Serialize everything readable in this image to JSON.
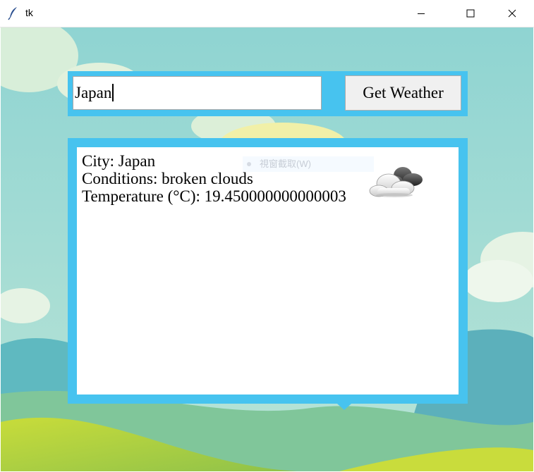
{
  "window": {
    "title": "tk",
    "icon": "feather-icon"
  },
  "search": {
    "value": "Japan",
    "button_label": "Get Weather"
  },
  "result": {
    "city_line": "City: Japan",
    "conditions_line": "Conditions: broken clouds",
    "temperature_line": "Temperature (°C): 19.450000000000003",
    "weather_icon": "broken-clouds-icon",
    "overlay_text": "視窗截取(W)"
  },
  "colors": {
    "panel_accent": "#47c3ef",
    "button_bg": "#f0f0f0",
    "sky": "#9ed8d0",
    "grass": "#b6d43a"
  }
}
